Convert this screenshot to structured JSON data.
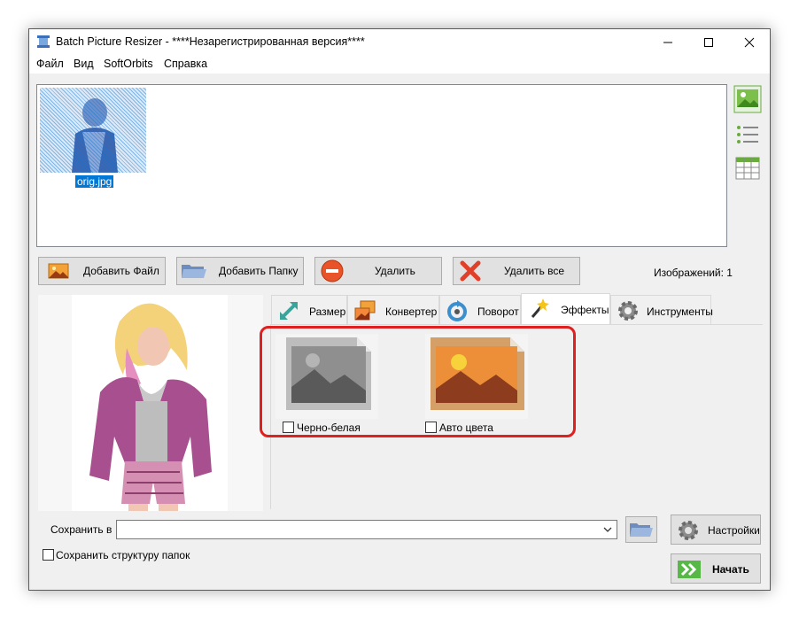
{
  "window": {
    "title": "Batch Picture Resizer - ****Незарегистрированная версия****"
  },
  "menu": {
    "file": "Файл",
    "view": "Вид",
    "softorbits": "SoftOrbits",
    "help": "Справка"
  },
  "file_list": {
    "items": [
      {
        "name": "orig.jpg"
      }
    ]
  },
  "view_icons": [
    "thumbnail-view-icon",
    "list-view-icon",
    "table-view-icon"
  ],
  "actions": {
    "add_file": "Добавить Файл",
    "add_folder": "Добавить Папку",
    "delete": "Удалить",
    "delete_all": "Удалить все"
  },
  "image_count_label": "Изображений: 1",
  "tabs": [
    {
      "label": "Размер",
      "icon": "resize-arrows-icon"
    },
    {
      "label": "Конвертер",
      "icon": "converter-icon"
    },
    {
      "label": "Поворот",
      "icon": "rotate-icon"
    },
    {
      "label": "Эффекты",
      "icon": "magic-wand-icon"
    },
    {
      "label": "Инструменты",
      "icon": "gear-icon"
    }
  ],
  "active_tab": "Эффекты",
  "effects": [
    {
      "label": "Черно-белая",
      "checked": false
    },
    {
      "label": "Авто цвета",
      "checked": false
    }
  ],
  "output": {
    "save_in_label": "Сохранить в",
    "save_in_value": "",
    "keep_structure_label": "Сохранить структуру папок",
    "keep_structure_checked": false,
    "settings_label": "Настройки",
    "start_label": "Начать"
  },
  "colors": {
    "accent_blue": "#0078d7",
    "highlight_red": "#e02020",
    "start_green": "#4caf50"
  }
}
